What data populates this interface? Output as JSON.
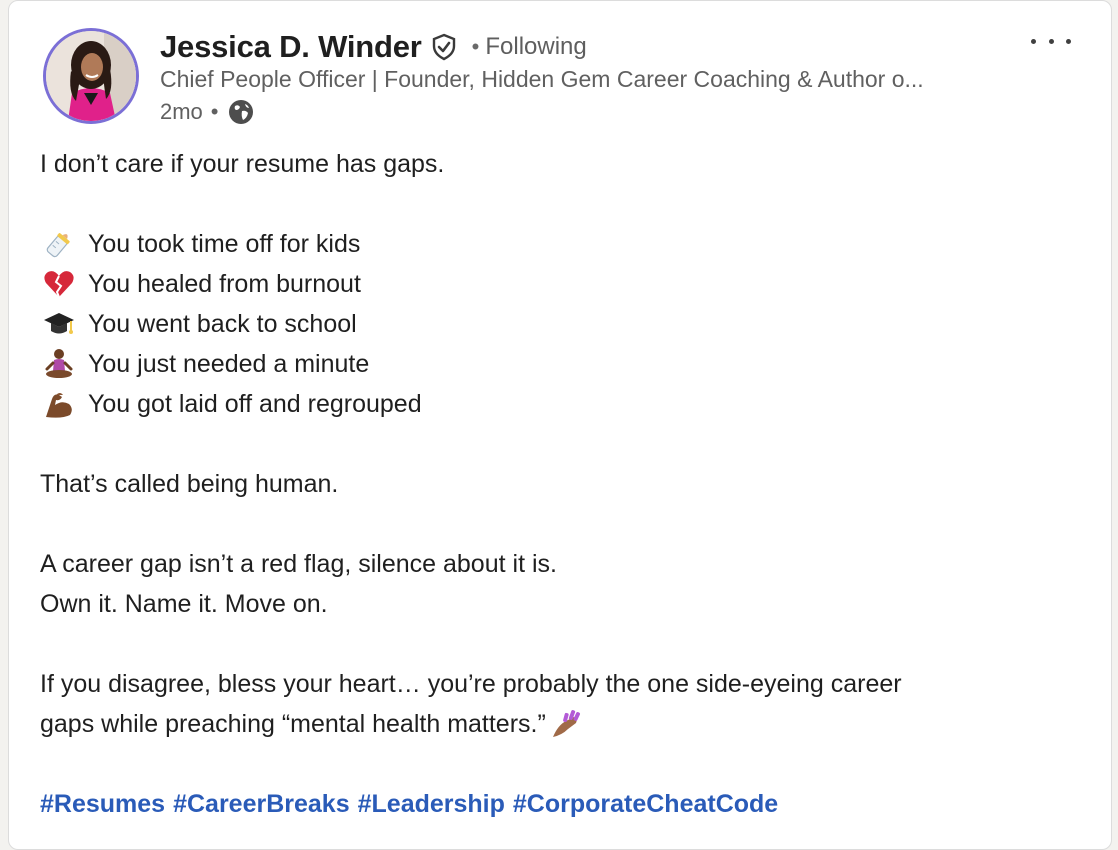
{
  "author": {
    "name": "Jessica D. Winder",
    "follow_status": "Following",
    "follow_dot": "•",
    "headline": "Chief People Officer | Founder, Hidden Gem Career Coaching & Author o...",
    "time": "2mo",
    "time_dot": "•",
    "visibility_icon": "globe-icon",
    "verified_icon": "verified-shield-icon"
  },
  "post": {
    "intro": "I don’t care if your resume has gaps.",
    "reasons": [
      {
        "icon": "baby-bottle-emoji",
        "text": "You took time off for kids"
      },
      {
        "icon": "broken-heart-emoji",
        "text": "You healed from burnout"
      },
      {
        "icon": "graduation-cap-emoji",
        "text": "You went back to school"
      },
      {
        "icon": "meditating-person-emoji",
        "text": "You just needed a minute"
      },
      {
        "icon": "flexed-biceps-emoji",
        "text": "You got laid off and regrouped"
      }
    ],
    "human": "That’s called being human.",
    "gap_line1": "A career gap isn’t a red flag, silence about it is.",
    "gap_line2": "Own it. Name it. Move on.",
    "disagree_line1": "If you disagree, bless your heart… you’re probably the one side-eyeing career",
    "disagree_line2": "gaps while preaching “mental health matters.”",
    "disagree_emoji": "nail-polish-emoji",
    "hashtags": [
      "#Resumes",
      "#CareerBreaks",
      "#Leadership",
      "#CorporateCheatCode"
    ]
  },
  "menu_icon": "more-options-icon",
  "colors": {
    "hashtag": "#2a5bb8",
    "avatar_ring": "#7b6fd6",
    "text": "#1f1f1f",
    "muted": "#606060"
  }
}
